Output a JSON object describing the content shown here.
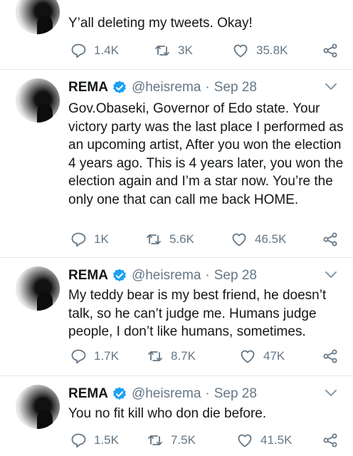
{
  "tweets": [
    {
      "name": "",
      "handle": "",
      "date": "",
      "text": "Y’all deleting my tweets. Okay!",
      "replies": "1.4K",
      "retweets": "3K",
      "likes": "35.8K"
    },
    {
      "name": "REMA",
      "handle": "@heisrema",
      "date": "Sep 28",
      "text": "Gov.Obaseki, Governor of Edo state. Your victory party was the last place I performed as an upcoming artist, After you won the election 4 years ago. This is 4 years later, you won the election again and I’m a star now. You’re the only one that can call me back HOME.",
      "replies": "1K",
      "retweets": "5.6K",
      "likes": "46.5K"
    },
    {
      "name": "REMA",
      "handle": "@heisrema",
      "date": "Sep 28",
      "text": "My teddy bear is my best friend, he doesn’t talk, so he can’t judge me. Humans judge people, I don’t like humans, sometimes.",
      "replies": "1.7K",
      "retweets": "8.7K",
      "likes": "47K"
    },
    {
      "name": "REMA",
      "handle": "@heisrema",
      "date": "Sep 28",
      "text": "You no fit kill who don die before.",
      "replies": "1.5K",
      "retweets": "7.5K",
      "likes": "41.5K"
    }
  ],
  "separator": "·",
  "colors": {
    "text": "#14171a",
    "muted": "#657786",
    "verified": "#1da1f2",
    "divider": "#e1e8ed"
  }
}
